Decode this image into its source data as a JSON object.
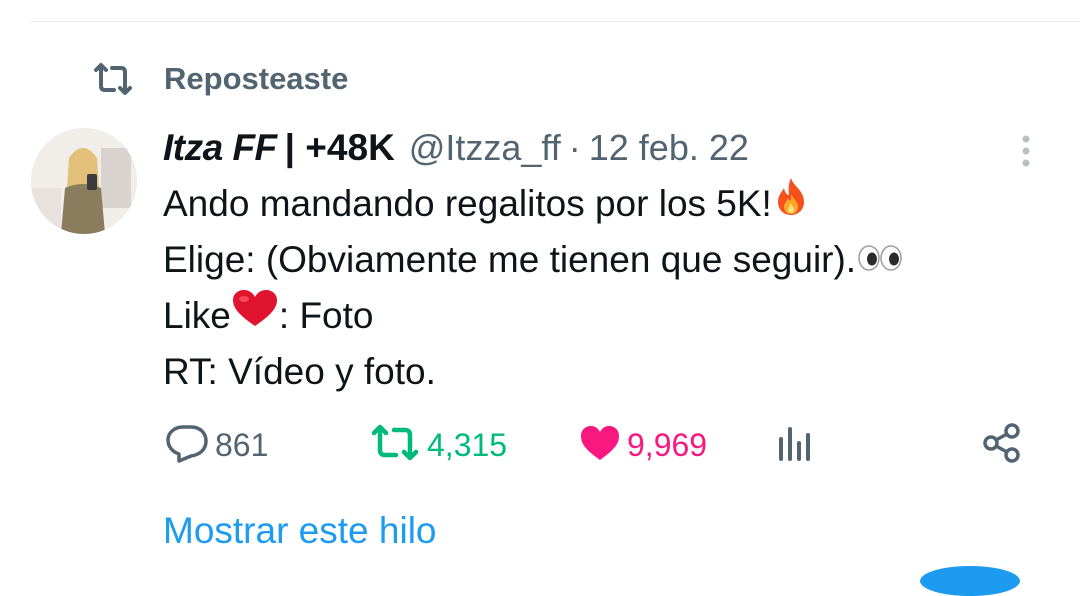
{
  "repost": {
    "label": "Reposteaste",
    "icon": "repost-icon"
  },
  "tweet": {
    "display_name": "Itza FF",
    "name_suffix": "| +48K",
    "handle": "@Itzza_ff",
    "separator": "·",
    "date": "12 feb. 22",
    "lines": [
      {
        "text": "Ando mandando regalitos por los 5K!",
        "emoji": "fire-emoji"
      },
      {
        "text": "Elige: (Obviamente me tienen que seguir).",
        "emoji": "eyes-emoji"
      },
      {
        "text_before": "Like",
        "emoji": "heart-emoji",
        "text_after": ": Foto"
      },
      {
        "text": "RT: Vídeo y foto."
      }
    ]
  },
  "actions": {
    "replies": "861",
    "reposts": "4,315",
    "likes": "9,969"
  },
  "colors": {
    "repost_active": "#00ba7c",
    "like_active": "#f91880",
    "link": "#1d9bf0",
    "muted": "#536471"
  },
  "show_thread": "Mostrar este hilo"
}
